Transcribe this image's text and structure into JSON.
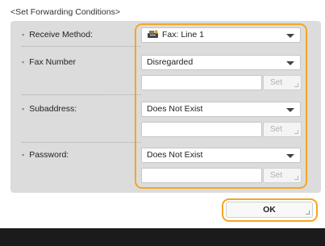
{
  "screen_title": "<Set Forwarding Conditions>",
  "rows": {
    "receive_method": {
      "label": "Receive Method:",
      "value": "Fax: Line 1"
    },
    "fax_number": {
      "label": "Fax Number",
      "value": "Disregarded",
      "text": "",
      "set_label": "Set"
    },
    "subaddress": {
      "label": "Subaddress:",
      "value": "Does Not Exist",
      "text": "",
      "set_label": "Set"
    },
    "password": {
      "label": "Password:",
      "value": "Does Not Exist",
      "text": "",
      "set_label": "Set"
    }
  },
  "ok_label": "OK",
  "colors": {
    "highlight": "#f5a623",
    "panel": "#dcdcdc",
    "bottom_bar": "#1b1b1b",
    "bullet": "#6b8fbf"
  },
  "icons": {
    "receive_method": "fax-machine-icon",
    "dropdown": "chevron-down-icon"
  }
}
